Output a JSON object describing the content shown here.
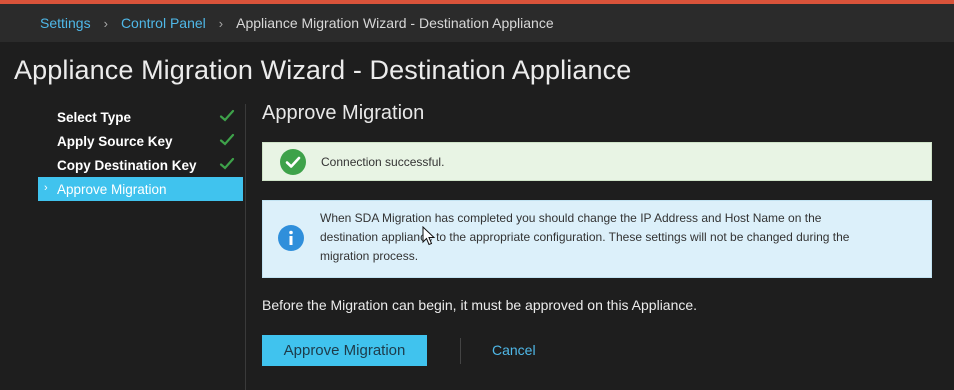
{
  "breadcrumb": {
    "items": [
      "Settings",
      "Control Panel"
    ],
    "current": "Appliance Migration Wizard - Destination Appliance",
    "separator": "›"
  },
  "page": {
    "title": "Appliance Migration Wizard - Destination Appliance"
  },
  "wizard": {
    "steps": [
      {
        "label": "Select Type",
        "status": "complete"
      },
      {
        "label": "Apply Source Key",
        "status": "complete"
      },
      {
        "label": "Copy Destination Key",
        "status": "complete"
      },
      {
        "label": "Approve Migration",
        "status": "active"
      }
    ]
  },
  "main": {
    "section_title": "Approve Migration",
    "success_message": "Connection successful.",
    "info_message": "When SDA Migration has completed you should change the IP Address and Host Name on the destination appliance to the appropriate configuration. These settings will not be changed during the migration process.",
    "instruction": "Before the Migration can begin, it must be approved on this Appliance.",
    "approve_label": "Approve Migration",
    "cancel_label": "Cancel"
  },
  "colors": {
    "accent": "#40c3ee",
    "link": "#4fb8e8",
    "success": "#3ea24a",
    "info": "#2f8fdb",
    "top_bar": "#d9533a"
  },
  "icons": {
    "step_complete": "check-icon",
    "success": "check-circle-icon",
    "info": "info-circle-icon",
    "active_step": "chevron-right-icon"
  }
}
